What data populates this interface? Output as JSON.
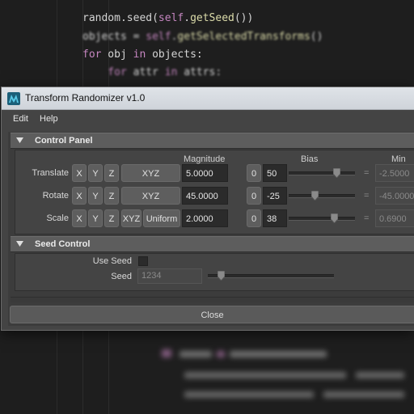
{
  "editor": {
    "lines": [
      {
        "parts": [
          [
            "random.seed(",
            "op"
          ],
          [
            "self",
            "self"
          ],
          [
            ".",
            "op"
          ],
          [
            "getSeed",
            "fn"
          ],
          [
            "())",
            "op"
          ]
        ]
      },
      {
        "parts": [
          [
            "objects = ",
            "op"
          ],
          [
            "self",
            "self"
          ],
          [
            ".",
            "op"
          ],
          [
            "getSelectedTransforms",
            "fn"
          ],
          [
            "()",
            "op"
          ]
        ]
      },
      {
        "parts": [
          [
            "for",
            "kw"
          ],
          [
            " obj ",
            "op"
          ],
          [
            "in",
            "kw"
          ],
          [
            " objects:",
            "op"
          ]
        ]
      },
      {
        "parts": [
          [
            "    for",
            "kw"
          ],
          [
            " attr ",
            "op"
          ],
          [
            "in",
            "kw"
          ],
          [
            " attrs:",
            "op"
          ]
        ]
      }
    ]
  },
  "window": {
    "title": "Transform Randomizer v1.0",
    "menu": {
      "edit": "Edit",
      "help": "Help"
    },
    "close_label": "Close"
  },
  "control_panel": {
    "header": "Control Panel",
    "columns": {
      "magnitude": "Magnitude",
      "bias": "Bias",
      "min": "Min"
    },
    "rows": [
      {
        "label": "Translate",
        "x": "X",
        "y": "Y",
        "z": "Z",
        "xyz": "XYZ",
        "uniform": "",
        "magnitude": "5.0000",
        "bias_reset": "0",
        "bias": "50",
        "bias_fraction": 0.72,
        "equals": "=",
        "min": "-2.5000"
      },
      {
        "label": "Rotate",
        "x": "X",
        "y": "Y",
        "z": "Z",
        "xyz": "XYZ",
        "uniform": "",
        "magnitude": "45.0000",
        "bias_reset": "0",
        "bias": "-25",
        "bias_fraction": 0.39,
        "equals": "=",
        "min": "-45.0000"
      },
      {
        "label": "Scale",
        "x": "X",
        "y": "Y",
        "z": "Z",
        "xyz": "XYZ",
        "uniform": "Uniform",
        "magnitude": "2.0000",
        "bias_reset": "0",
        "bias": "38",
        "bias_fraction": 0.68,
        "equals": "=",
        "min": "0.6900"
      }
    ]
  },
  "seed_control": {
    "header": "Seed Control",
    "use_seed_label": "Use Seed",
    "use_seed_checked": false,
    "seed_label": "Seed",
    "seed_placeholder": "1234",
    "seed_fraction": 0.1
  },
  "colors": {
    "accent_purple": "#c586c0",
    "function_yellow": "#dcdcaa"
  }
}
